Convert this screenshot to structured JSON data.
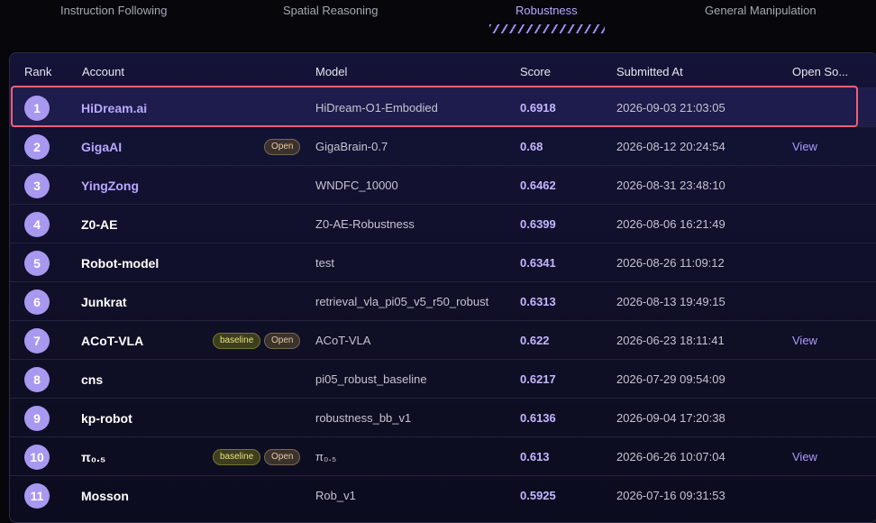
{
  "tabs": [
    {
      "label": "Instruction Following",
      "active": false
    },
    {
      "label": "Spatial Reasoning",
      "active": false
    },
    {
      "label": "Robustness",
      "active": true
    },
    {
      "label": "General Manipulation",
      "active": false
    }
  ],
  "table": {
    "headers": {
      "rank": "Rank",
      "account": "Account",
      "model": "Model",
      "score": "Score",
      "submitted": "Submitted At",
      "open_source": "Open So..."
    },
    "rows": [
      {
        "rank": "1",
        "account": "HiDream.ai",
        "badges": [],
        "model": "HiDream-O1-Embodied",
        "score": "0.6918",
        "submitted": "2026-09-03 21:03:05",
        "open_source": ""
      },
      {
        "rank": "2",
        "account": "GigaAI",
        "badges": [
          "Open"
        ],
        "model": "GigaBrain-0.7",
        "score": "0.68",
        "submitted": "2026-08-12 20:24:54",
        "open_source": "View"
      },
      {
        "rank": "3",
        "account": "YingZong",
        "badges": [],
        "model": "WNDFC_10000",
        "score": "0.6462",
        "submitted": "2026-08-31 23:48:10",
        "open_source": ""
      },
      {
        "rank": "4",
        "account": "Z0-AE",
        "badges": [],
        "model": "Z0-AE-Robustness",
        "score": "0.6399",
        "submitted": "2026-08-06 16:21:49",
        "open_source": ""
      },
      {
        "rank": "5",
        "account": "Robot-model",
        "badges": [],
        "model": "test",
        "score": "0.6341",
        "submitted": "2026-08-26 11:09:12",
        "open_source": ""
      },
      {
        "rank": "6",
        "account": "Junkrat",
        "badges": [],
        "model": "retrieval_vla_pi05_v5_r50_robust",
        "score": "0.6313",
        "submitted": "2026-08-13 19:49:15",
        "open_source": ""
      },
      {
        "rank": "7",
        "account": "ACoT-VLA",
        "badges": [
          "baseline",
          "Open"
        ],
        "model": "ACoT-VLA",
        "score": "0.622",
        "submitted": "2026-06-23 18:11:41",
        "open_source": "View"
      },
      {
        "rank": "8",
        "account": "cns",
        "badges": [],
        "model": "pi05_robust_baseline",
        "score": "0.6217",
        "submitted": "2026-07-29 09:54:09",
        "open_source": ""
      },
      {
        "rank": "9",
        "account": "kp-robot",
        "badges": [],
        "model": "robustness_bb_v1",
        "score": "0.6136",
        "submitted": "2026-09-04 17:20:38",
        "open_source": ""
      },
      {
        "rank": "10",
        "account": "π₀.₅",
        "badges": [
          "baseline",
          "Open"
        ],
        "model": "π₀.₅",
        "score": "0.613",
        "submitted": "2026-06-26 10:07:04",
        "open_source": "View"
      },
      {
        "rank": "11",
        "account": "Mosson",
        "badges": [],
        "model": "Rob_v1",
        "score": "0.5925",
        "submitted": "2026-07-16 09:31:53",
        "open_source": ""
      }
    ]
  },
  "colors": {
    "accent": "#a898f0",
    "score": "#c3b6ff",
    "highlight_border": "#f06072"
  }
}
